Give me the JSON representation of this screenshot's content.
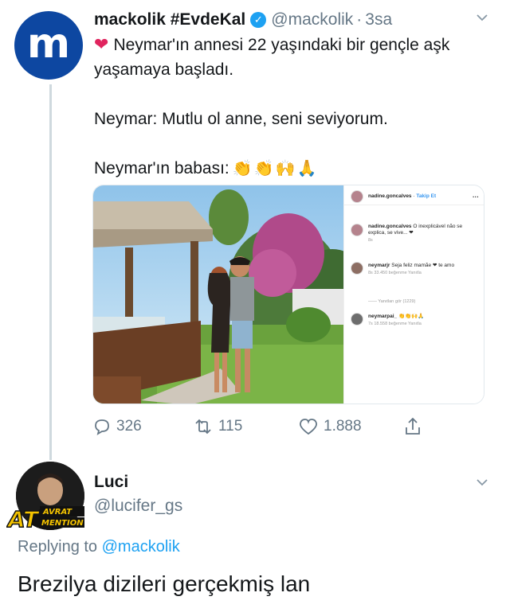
{
  "tweet": {
    "author_name": "mackolik #EvdeKal",
    "handle": "@mackolik",
    "separator": "·",
    "time": "3sa",
    "lines": [
      "Neymar'ın annesi 22 yaşındaki bir gençle aşk yaşamaya başladı.",
      "Neymar: Mutlu ol anne, seni seviyorum.",
      "Neymar'ın babası:"
    ],
    "emojis": "👏👏🙌🙏",
    "avatar_letter": "m",
    "media": {
      "ig_header_user": "nadine.goncalves",
      "ig_follow": "Takip Et",
      "ig_comments": [
        {
          "user": "nadine.goncalves",
          "text": "O inexplicável não se explica, se vive... ❤",
          "meta": "8s"
        },
        {
          "user": "neymarjr",
          "text": "Seja feliz mamãe ❤ te amo",
          "meta": "8s   33.450 beğenme   Yanıtla"
        },
        {
          "user": "",
          "text": "—— Yanıtları gör (1229)",
          "meta": ""
        },
        {
          "user": "neymarpai_",
          "text": "👏👏🙌🙏",
          "meta": "7s   18.558 beğenme   Yanıtla"
        }
      ]
    },
    "actions": {
      "replies": "326",
      "retweets": "115",
      "likes": "1.888"
    }
  },
  "reply": {
    "author_name": "Luci",
    "handle": "@lucifer_gs",
    "badge_line1": "AVRAT",
    "badge_line2": "MENTION",
    "badge_big": "AT",
    "replying_prefix": "Replying to",
    "replying_to": "@mackolik",
    "text": "Brezilya dizileri gerçekmiş lan"
  },
  "colors": {
    "accent": "#1da1f2",
    "muted": "#657786",
    "heart": "#e0245e",
    "mackolik_blue": "#0d47a1"
  }
}
